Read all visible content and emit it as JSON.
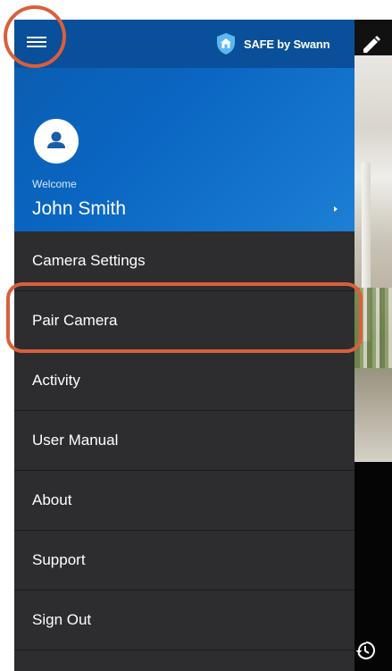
{
  "app": {
    "brand_name": "SAFE by Swann",
    "accent_color": "#0a66c2",
    "highlight_color": "#d9603b"
  },
  "header": {
    "menu_icon": "hamburger-menu-icon",
    "edit_icon": "pencil-edit-icon"
  },
  "profile": {
    "welcome_label": "Welcome",
    "user_name": "John Smith"
  },
  "menu": {
    "items": [
      {
        "label": "Camera Settings"
      },
      {
        "label": "Pair Camera"
      },
      {
        "label": "Activity"
      },
      {
        "label": "User Manual"
      },
      {
        "label": "About"
      },
      {
        "label": "Support"
      },
      {
        "label": "Sign Out"
      }
    ]
  }
}
